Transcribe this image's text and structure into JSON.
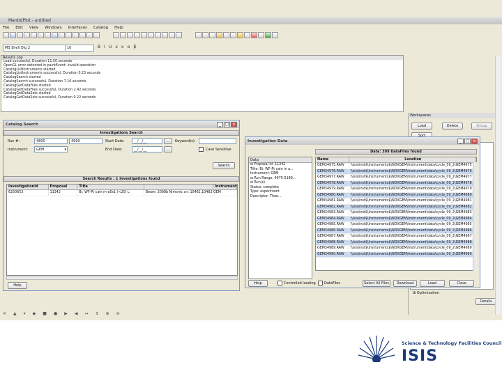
{
  "window": {
    "title": "MantidPlot - untitled"
  },
  "menu": [
    "File",
    "Edit",
    "View",
    "Windows",
    "Interfaces",
    "Catalog",
    "Help"
  ],
  "script_selector": {
    "value": "MS Shell Dlg 2",
    "size": "10"
  },
  "results_log": {
    "title": "Results Log",
    "lines": [
      "Load successful, Duration 11.56 seconds",
      "OpenGL error detected in paintEvent: invalid operation",
      "CatalogListInstruments started",
      "CatalogListInstruments successful, Duration 0.23 seconds",
      "CatalogSearch started",
      "CatalogSearch successful, Duration 7.16 seconds",
      "CatalogGetDataFiles started",
      "CatalogGetDataFiles successful, Duration 2.42 seconds",
      "CatalogGetDataSets started",
      "CatalogGetDataSets successful, Duration 0.22 seconds"
    ]
  },
  "workspaces": {
    "title": "Workspaces",
    "load": "Load",
    "delete": "Delete",
    "group": "Group",
    "sort": "Sort",
    "optimization": "Optimization",
    "details": "Details"
  },
  "catalog_search": {
    "title": "Catalog Search",
    "section_title": "Investigations Search",
    "run_label": "Run #:",
    "run_from": "4800",
    "run_to": "4900",
    "start_date_label": "Start Date:",
    "start_date": "__/__/__",
    "end_date_label": "End Date:",
    "end_date": "__/__/__",
    "keywords_label": "Keyword(s):",
    "instrument_label": "Instrument:",
    "instrument": "GEM",
    "case_sensitive": "Case Sensitive",
    "search_btn": "Search",
    "results_title": "Search Results : 1 Investigations found",
    "columns": [
      "InvestigationId",
      "Proposal",
      "Title",
      "Instrument"
    ],
    "rows": [
      [
        "6250653",
        "11342",
        "Bi: WF-Pt cain m-a5s1 (<20) L",
        "Beam: 2008b  Nimonic cn: 10482,10482  GEM"
      ]
    ],
    "help_btn": "Help"
  },
  "investigation_data": {
    "title": "Investigation Data",
    "tree_title": "Data",
    "tree": [
      "⊟ Proposal Id: 11342",
      "    Title: Bi: WF-Pt cain in a...",
      "    Instrument: GEM",
      "  ⊟ Run Range: 4975-5189...",
      "    ⊟ Run(s)",
      "        Status: complete",
      "        Type: experiment",
      "        Descriptor: Thee..."
    ],
    "files_title": "Data: 399 DataFiles found",
    "columns": [
      "Name",
      "Location"
    ],
    "rows": [
      [
        "GEM34975.RAW",
        "\\\\isis\\inst$\\Instruments$\\NDXGEM\\Instrument\\data\\cycle_09_2\\GEM4975"
      ],
      [
        "GEM34976.RAW",
        "\\\\isis\\inst$\\Instruments$\\NDXGEM\\Instrument\\data\\cycle_09_2\\GEM4976"
      ],
      [
        "GEM34977.RAW",
        "\\\\isis\\inst$\\Instruments$\\NDXGEM\\Instrument\\data\\cycle_09_2\\GEM4977"
      ],
      [
        "GEM34978.RAW",
        "\\\\isis\\inst$\\Instruments$\\NDXGEM\\Instrument\\data\\cycle_09_2\\GEM4978"
      ],
      [
        "GEM34979.RAW",
        "\\\\isis\\inst$\\Instruments$\\NDXGEM\\Instrument\\data\\cycle_09_2\\GEM4979"
      ],
      [
        "GEM34980.RAW",
        "\\\\isis\\inst$\\Instruments$\\NDXGEM\\Instrument\\data\\cycle_09_2\\GEM4980"
      ],
      [
        "GEM34981.RAW",
        "\\\\isis\\inst$\\Instruments$\\NDXGEM\\Instrument\\data\\cycle_09_2\\GEM4981"
      ],
      [
        "GEM34982.RAW",
        "\\\\isis\\inst$\\Instruments$\\NDXGEM\\Instrument\\data\\cycle_09_2\\GEM4982"
      ],
      [
        "GEM34983.RAW",
        "\\\\isis\\inst$\\Instruments$\\NDXGEM\\Instrument\\data\\cycle_09_2\\GEM4983"
      ],
      [
        "GEM34984.RAW",
        "\\\\isis\\inst$\\Instruments$\\NDXGEM\\Instrument\\data\\cycle_09_2\\GEM4984"
      ],
      [
        "GEM34985.RAW",
        "\\\\isis\\inst$\\Instruments$\\NDXGEM\\Instrument\\data\\cycle_09_2\\GEM4985"
      ],
      [
        "GEM34986.RAW",
        "\\\\isis\\inst$\\Instruments$\\NDXGEM\\Instrument\\data\\cycle_09_2\\GEM4986"
      ],
      [
        "GEM34987.RAW",
        "\\\\isis\\inst$\\Instruments$\\NDXGEM\\Instrument\\data\\cycle_09_2\\GEM4987"
      ],
      [
        "GEM34988.RAW",
        "\\\\isis\\inst$\\Instruments$\\NDXGEM\\Instrument\\data\\cycle_09_2\\GEM4988"
      ],
      [
        "GEM34989.RAW",
        "\\\\isis\\inst$\\Instruments$\\NDXGEM\\Instrument\\data\\cycle_09_2\\GEM4989"
      ],
      [
        "GEM34990.RAW",
        "\\\\isis\\inst$\\Instruments$\\NDXGEM\\Instrument\\data\\cycle_09_2\\GEM4990"
      ]
    ],
    "help_btn": "Help",
    "controlled_loading": "Controlled loading",
    "data_files": "DataFiles",
    "select_all": "Select All Files",
    "download": "Download",
    "load": "Load",
    "close": "Close"
  },
  "branding": {
    "org": "Science & Technology Facilities Council",
    "name": "ISIS",
    "accent": "#1c3a7a"
  }
}
